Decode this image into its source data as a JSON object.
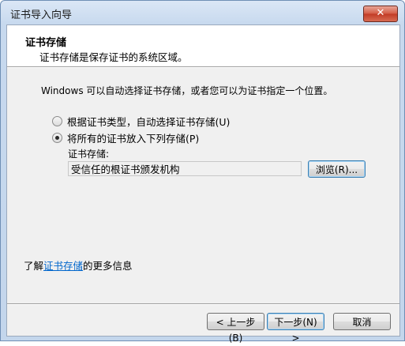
{
  "window": {
    "title": "证书导入向导",
    "close_label": "✕"
  },
  "header": {
    "title": "证书存储",
    "subtitle": "证书存储是保存证书的系统区域。"
  },
  "intro_text": "Windows 可以自动选择证书存储，或者您可以为证书指定一个位置。",
  "options": [
    {
      "label": "根据证书类型，自动选择证书存储(U)",
      "checked": false
    },
    {
      "label": "将所有的证书放入下列存储(P)",
      "checked": true
    }
  ],
  "store": {
    "label": "证书存储:",
    "value": "受信任的根证书颁发机构",
    "browse_label": "浏览(R)..."
  },
  "more_info": {
    "prefix": "了解",
    "link": "证书存储",
    "suffix": "的更多信息"
  },
  "footer": {
    "back_label": "< 上一步(B)",
    "next_label": "下一步(N) >",
    "cancel_label": "取消"
  }
}
